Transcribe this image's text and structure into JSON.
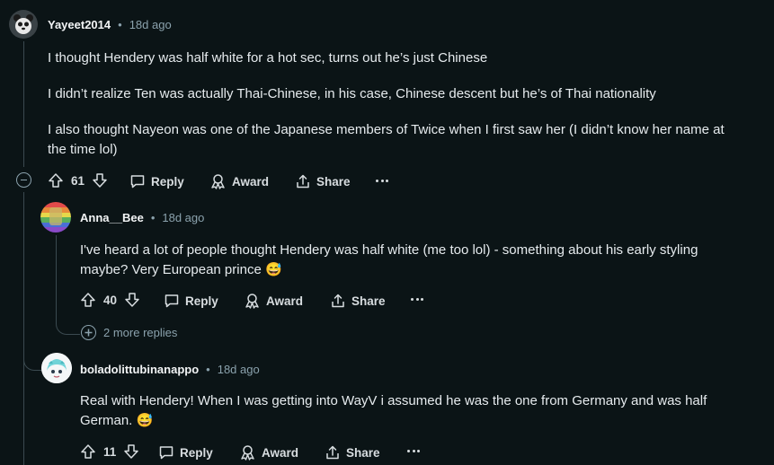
{
  "comments": [
    {
      "username": "Yayeet2014",
      "time": "18d ago",
      "paragraphs": [
        "I thought Hendery was half white for a hot sec, turns out he’s just Chinese",
        "I didn’t realize Ten was actually Thai-Chinese, in his case, Chinese descent but he’s of Thai nationality",
        "I also thought Nayeon was one of the Japanese members of Twice when I first saw her (I didn’t know her name at",
        "the time lol)"
      ],
      "votes": "61"
    },
    {
      "username": "Anna__Bee",
      "time": "18d ago",
      "lines": [
        "I've heard a lot of people thought Hendery was half white (me too lol) - something about his early styling",
        "maybe? Very European prince"
      ],
      "votes": "40"
    },
    {
      "username": "boladolittubinanappo",
      "time": "18d ago",
      "lines": [
        "Real with Hendery! When I was getting into WayV i assumed he was the one from Germany and was half",
        "German."
      ],
      "votes": "11"
    }
  ],
  "labels": {
    "reply": "Reply",
    "award": "Award",
    "share": "Share",
    "dot": "•",
    "more_replies": "2 more replies",
    "emoji": "😅"
  }
}
